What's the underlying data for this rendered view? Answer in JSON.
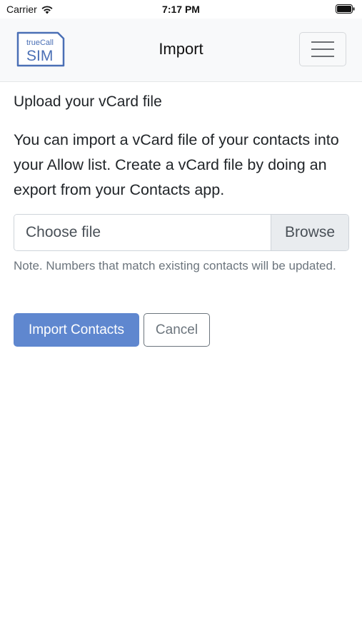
{
  "status_bar": {
    "carrier": "Carrier",
    "time": "7:17 PM",
    "icons": [
      "wifi-icon",
      "battery-icon"
    ]
  },
  "navbar": {
    "logo": {
      "line1": "trueCall",
      "line2": "SIM"
    },
    "title": "Import",
    "menu_icon": "hamburger-menu-icon"
  },
  "content": {
    "heading": "Upload your vCard file",
    "description": "You can import a vCard file of your contacts into your Allow list. Create a vCard file by doing an export from your Contacts app.",
    "file_input": {
      "placeholder": "Choose file",
      "browse_label": "Browse"
    },
    "note": "Note. Numbers that match existing contacts will be updated.",
    "import_button": "Import Contacts",
    "cancel_button": "Cancel"
  },
  "colors": {
    "primary": "#5f87cf",
    "logo_blue": "#4a6fb5",
    "navbar_bg": "#f8f9fa",
    "muted_text": "#6c757d"
  }
}
